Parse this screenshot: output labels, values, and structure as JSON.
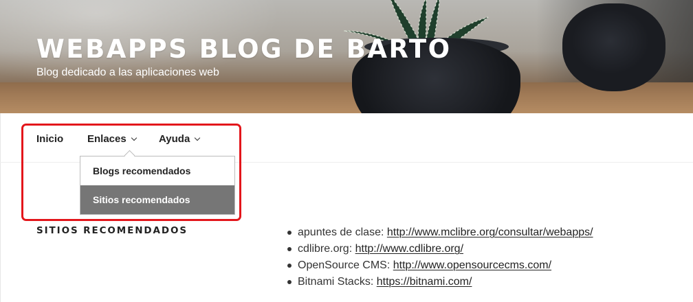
{
  "header": {
    "title": "WEBAPPS BLOG DE BARTO",
    "tagline": "Blog dedicado a las aplicaciones web"
  },
  "nav": {
    "items": [
      {
        "label": "Inicio",
        "has_submenu": false
      },
      {
        "label": "Enlaces",
        "has_submenu": true,
        "expanded": true
      },
      {
        "label": "Ayuda",
        "has_submenu": true,
        "expanded": false
      }
    ],
    "dropdown": {
      "items": [
        {
          "label": "Blogs recomendados",
          "active": false
        },
        {
          "label": "Sitios recomendados",
          "active": true
        }
      ]
    }
  },
  "colors": {
    "annotation_border": "#e3161b",
    "dropdown_active_bg": "#767676",
    "text": "#222222"
  },
  "content": {
    "section_title": "SITIOS RECOMENDADOS",
    "links": [
      {
        "name": "apuntes de clase:",
        "url": "http://www.mclibre.org/consultar/webapps/"
      },
      {
        "name": "cdlibre.org:",
        "url": "http://www.cdlibre.org/"
      },
      {
        "name": "OpenSource CMS:",
        "url": "http://www.opensourcecms.com/"
      },
      {
        "name": "Bitnami Stacks:",
        "url": "https://bitnami.com/"
      }
    ]
  }
}
